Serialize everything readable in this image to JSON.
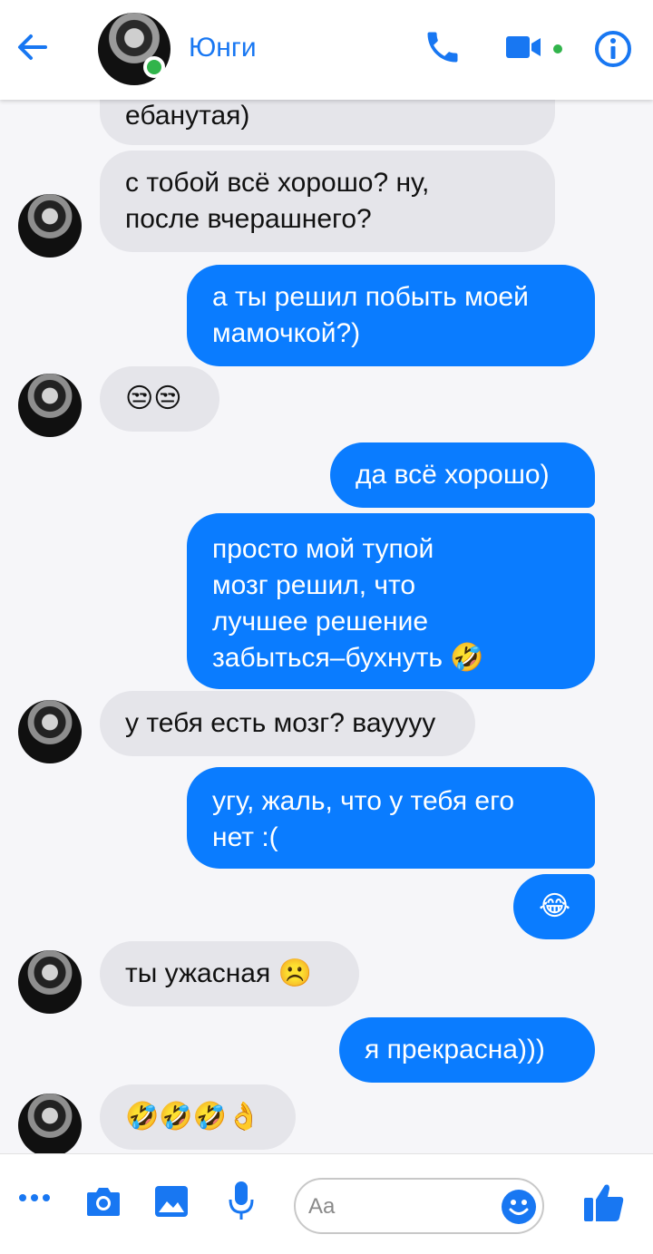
{
  "header": {
    "contact_name": "Юнги"
  },
  "messages": {
    "m0": "ебанутая)",
    "m1_l1": "с тобой всё хорошо? ну,",
    "m1_l2": "после вчерашнего?",
    "m2_l1": "а ты решил побыть моей",
    "m2_l2": "мамочкой?)",
    "m3": "😒😒",
    "m4": "да всё хорошо)",
    "m5_l1": "просто мой тупой",
    "m5_l2": "мозг решил, что",
    "m5_l3": "лучшее решение",
    "m5_l4": "забыться–бухнуть 🤣",
    "m6": "у тебя есть мозг? вауууу",
    "m7_l1": "угу, жаль, что у тебя его",
    "m7_l2": "нет :(",
    "m8": "😂",
    "m9": "ты ужасная ☹️",
    "m10": "я прекрасна)))",
    "m11": "🤣🤣🤣👌"
  },
  "composer": {
    "placeholder": "Aa"
  },
  "colors": {
    "accent": "#1877f2",
    "outgoing_bubble": "#0a7cff",
    "incoming_bubble": "#e5e5ea",
    "online": "#31b44b"
  },
  "icons": [
    "back-arrow-icon",
    "phone-icon",
    "video-camera-icon",
    "info-icon",
    "more-dots-icon",
    "camera-icon",
    "image-icon",
    "microphone-icon",
    "emoji-icon",
    "thumbs-up-icon"
  ]
}
